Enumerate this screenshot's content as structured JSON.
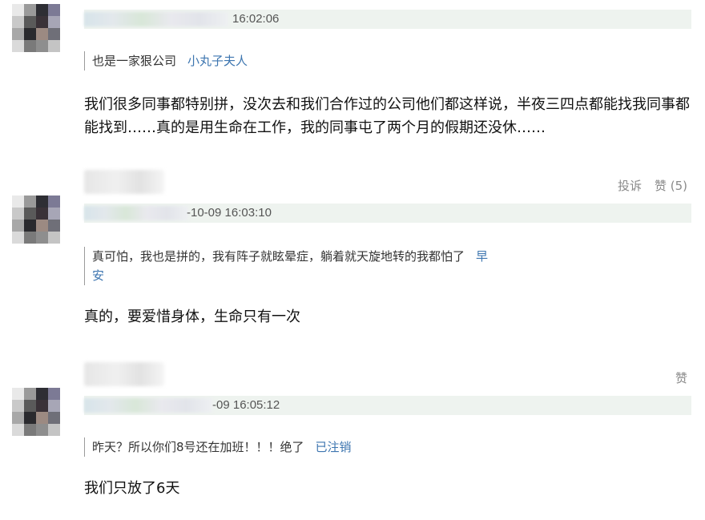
{
  "comments": [
    {
      "time": "16:02:06",
      "quote_text": "也是一家狠公司",
      "quote_author": "小丸子夫人",
      "text": "我们很多同事都特别拼，没次去和我们合作过的公司他们都这样说，半夜三四点都能找我同事都能找到……真的是用生命在工作，我的同事屯了两个月的假期还没休……",
      "report_label": "投诉",
      "like_label": "赞 (5)"
    },
    {
      "time": "-10-09 16:03:10",
      "quote_text": "真可怕，我也是拼的，我有阵子就眩晕症，躺着就天旋地转的我都怕了",
      "quote_author": "早 安",
      "text": "真的，要爱惜身体，生命只有一次",
      "like_label": "赞"
    },
    {
      "time": "-09 16:05:12",
      "quote_text": "昨天？所以你们8号还在加班！！！绝了",
      "quote_author": "已注销",
      "text": "我们只放了6天"
    }
  ],
  "colors": {
    "meta_bar": "#eef3ef",
    "link": "#3e76b0",
    "action_text": "#8a8a8a"
  }
}
